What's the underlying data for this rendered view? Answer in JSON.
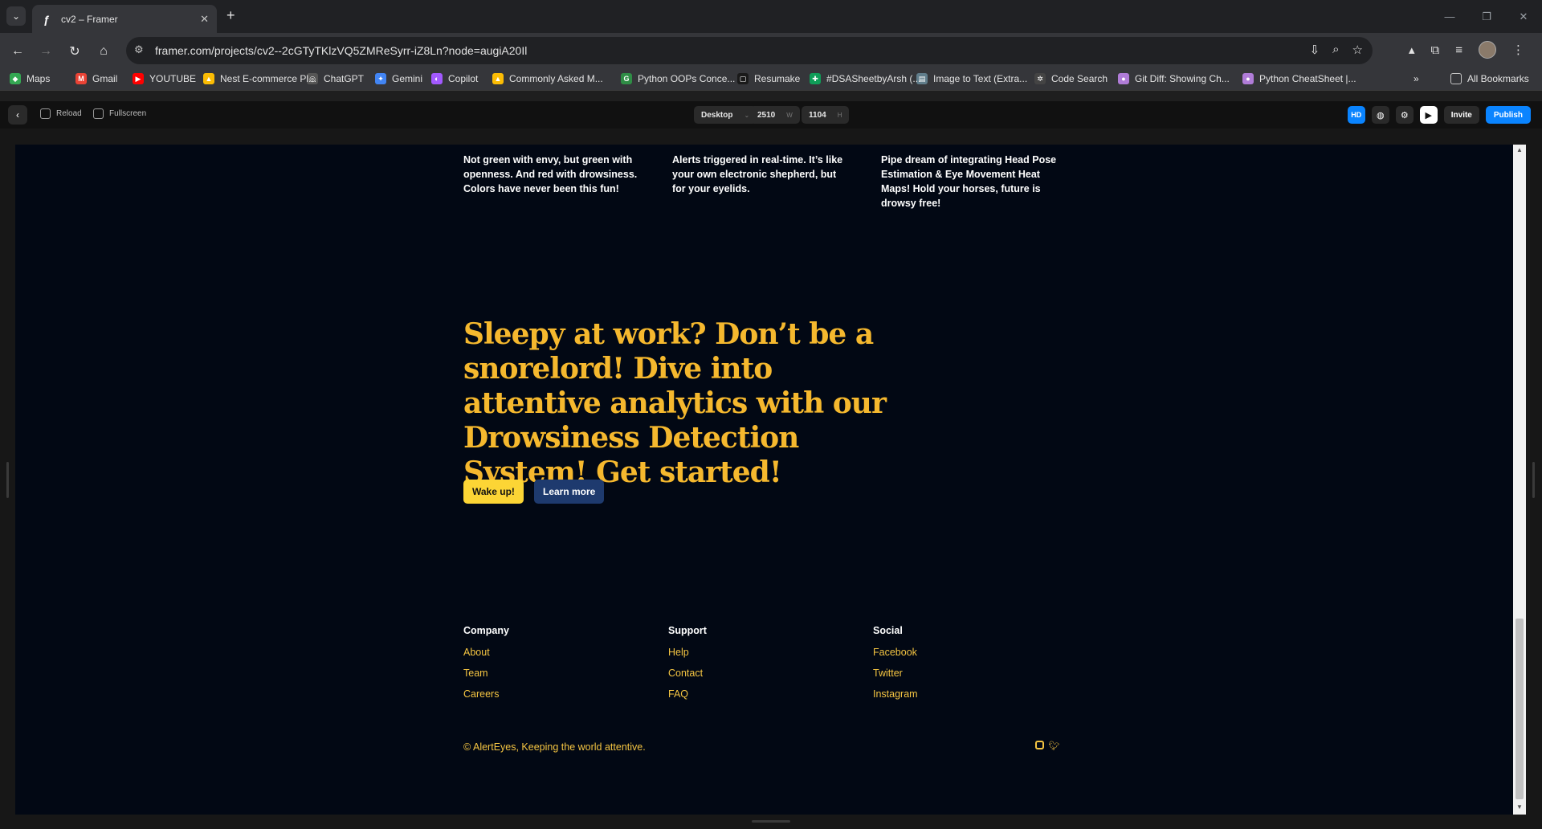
{
  "browser": {
    "tab_title": "cv2 – Framer",
    "url": "framer.com/projects/cv2--2cGTyTKlzVQ5ZMReSyrr-iZ8Ln?node=augiA20Il"
  },
  "bookmarks": [
    {
      "label": "Maps",
      "color": "#34a853",
      "glyph": "◆"
    },
    {
      "label": "Gmail",
      "color": "#ea4335",
      "glyph": "M"
    },
    {
      "label": "YOUTUBE",
      "color": "#ff0000",
      "glyph": "▶"
    },
    {
      "label": "Nest E-commerce Pl...",
      "color": "#fbbc04",
      "glyph": "▲"
    },
    {
      "label": "ChatGPT",
      "color": "#555555",
      "glyph": "◎"
    },
    {
      "label": "Gemini",
      "color": "#4285f4",
      "glyph": "✦"
    },
    {
      "label": "Copilot",
      "color": "#a259ff",
      "glyph": "◐"
    },
    {
      "label": "Commonly Asked M...",
      "color": "#fbbc04",
      "glyph": "▲"
    },
    {
      "label": "Python OOPs Conce...",
      "color": "#2f8d46",
      "glyph": "G"
    },
    {
      "label": "Resumake",
      "color": "#1a1a1a",
      "glyph": "▢"
    },
    {
      "label": "#DSASheetbyArsh (...",
      "color": "#0f9d58",
      "glyph": "✚"
    },
    {
      "label": "Image to Text (Extra...",
      "color": "#607d8b",
      "glyph": "▤"
    },
    {
      "label": "Code Search",
      "color": "#444444",
      "glyph": "✲"
    },
    {
      "label": "Git Diff: Showing Ch...",
      "color": "#b07cd8",
      "glyph": "●"
    },
    {
      "label": "Python CheatSheet |...",
      "color": "#b07cd8",
      "glyph": "●"
    }
  ],
  "bookmarks_overflow": "»",
  "all_bookmarks": "All Bookmarks",
  "framer": {
    "reload": "Reload",
    "fullscreen": "Fullscreen",
    "device": "Desktop",
    "width": "2510",
    "width_unit": "W",
    "height": "1104",
    "height_unit": "H",
    "hd": "HD",
    "invite": "Invite",
    "publish": "Publish"
  },
  "site": {
    "features": [
      "Not green with envy, but green with openness. And red with drowsiness. Colors have never been this fun!",
      "Alerts triggered in real-time. It’s like your own electronic shepherd, but for your eyelids.",
      "Pipe dream of integrating Head Pose Estimation & Eye Movement Heat Maps! Hold your horses, future is drowsy free!"
    ],
    "hero_title": "Sleepy at work? Don’t be a snorelord! Dive into attentive analytics with our Drowsiness Detection System! Get started!",
    "cta_primary": "Wake up!",
    "cta_secondary": "Learn more",
    "footer": {
      "columns": [
        {
          "heading": "Company",
          "links": [
            "About",
            "Team",
            "Careers"
          ]
        },
        {
          "heading": "Support",
          "links": [
            "Help",
            "Contact",
            "FAQ"
          ]
        },
        {
          "heading": "Social",
          "links": [
            "Facebook",
            "Twitter",
            "Instagram"
          ]
        }
      ],
      "copyright": "© AlertEyes, Keeping the world attentive."
    },
    "colors": {
      "background": "#020814",
      "accent": "#f5b82e",
      "primary_button": "#fcd535",
      "secondary_button": "#1e3a6e"
    }
  }
}
